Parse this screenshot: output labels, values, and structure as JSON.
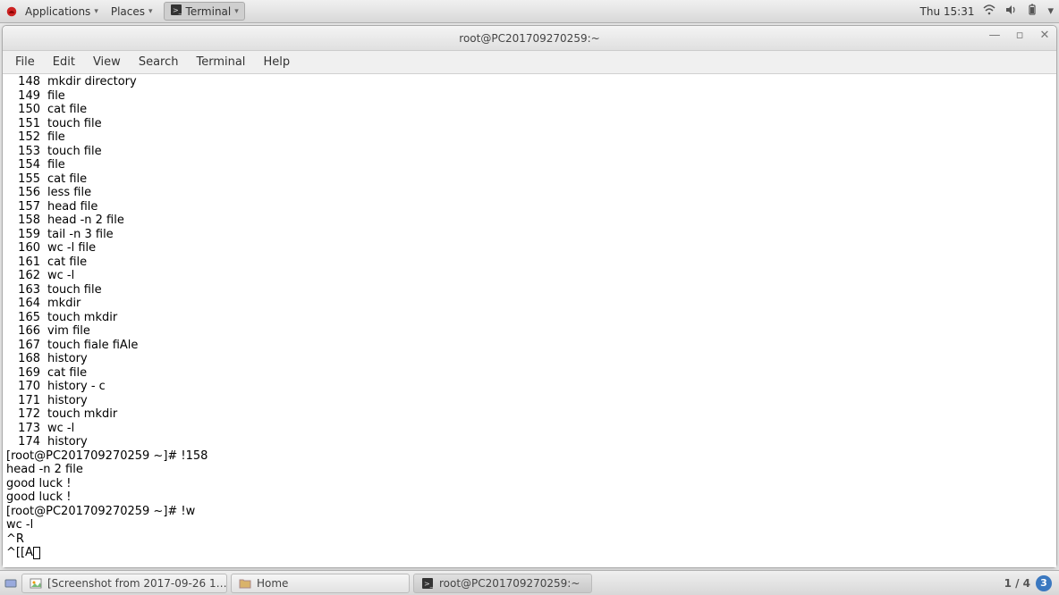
{
  "top_panel": {
    "applications": "Applications",
    "places": "Places",
    "active_app": "Terminal",
    "clock": "Thu 15:31"
  },
  "window": {
    "title": "root@PC201709270259:~",
    "menubar": [
      "File",
      "Edit",
      "View",
      "Search",
      "Terminal",
      "Help"
    ]
  },
  "terminal": {
    "history": [
      {
        "n": "148",
        "cmd": "mkdir directory"
      },
      {
        "n": "149",
        "cmd": "file"
      },
      {
        "n": "150",
        "cmd": "cat file"
      },
      {
        "n": "151",
        "cmd": "touch file"
      },
      {
        "n": "152",
        "cmd": "file"
      },
      {
        "n": "153",
        "cmd": "touch file"
      },
      {
        "n": "154",
        "cmd": "file"
      },
      {
        "n": "155",
        "cmd": "cat file"
      },
      {
        "n": "156",
        "cmd": "less file"
      },
      {
        "n": "157",
        "cmd": "head file"
      },
      {
        "n": "158",
        "cmd": "head -n 2 file"
      },
      {
        "n": "159",
        "cmd": "tail -n 3 file"
      },
      {
        "n": "160",
        "cmd": "wc -l file"
      },
      {
        "n": "161",
        "cmd": "cat file"
      },
      {
        "n": "162",
        "cmd": "wc -l"
      },
      {
        "n": "163",
        "cmd": "touch file"
      },
      {
        "n": "164",
        "cmd": "mkdir"
      },
      {
        "n": "165",
        "cmd": "touch mkdir"
      },
      {
        "n": "166",
        "cmd": "vim file"
      },
      {
        "n": "167",
        "cmd": "touch fiale fiAle"
      },
      {
        "n": "168",
        "cmd": "history"
      },
      {
        "n": "169",
        "cmd": "cat file"
      },
      {
        "n": "170",
        "cmd": "history - c"
      },
      {
        "n": "171",
        "cmd": "history"
      },
      {
        "n": "172",
        "cmd": "touch mkdir"
      },
      {
        "n": "173",
        "cmd": "wc -l"
      },
      {
        "n": "174",
        "cmd": "history"
      }
    ],
    "tail": [
      "[root@PC201709270259 ~]# !158",
      "head -n 2 file",
      "good luck !",
      "good luck !",
      "[root@PC201709270259 ~]# !w",
      "wc -l",
      "^R"
    ],
    "cursor_prefix": "^[[A"
  },
  "taskbar": {
    "items": [
      {
        "icon": "screenshot",
        "label": "[Screenshot from 2017-09-26 1…"
      },
      {
        "icon": "folder",
        "label": "Home"
      },
      {
        "icon": "terminal",
        "label": "root@PC201709270259:~"
      }
    ],
    "workspace": "1 / 4",
    "badge": "3"
  }
}
